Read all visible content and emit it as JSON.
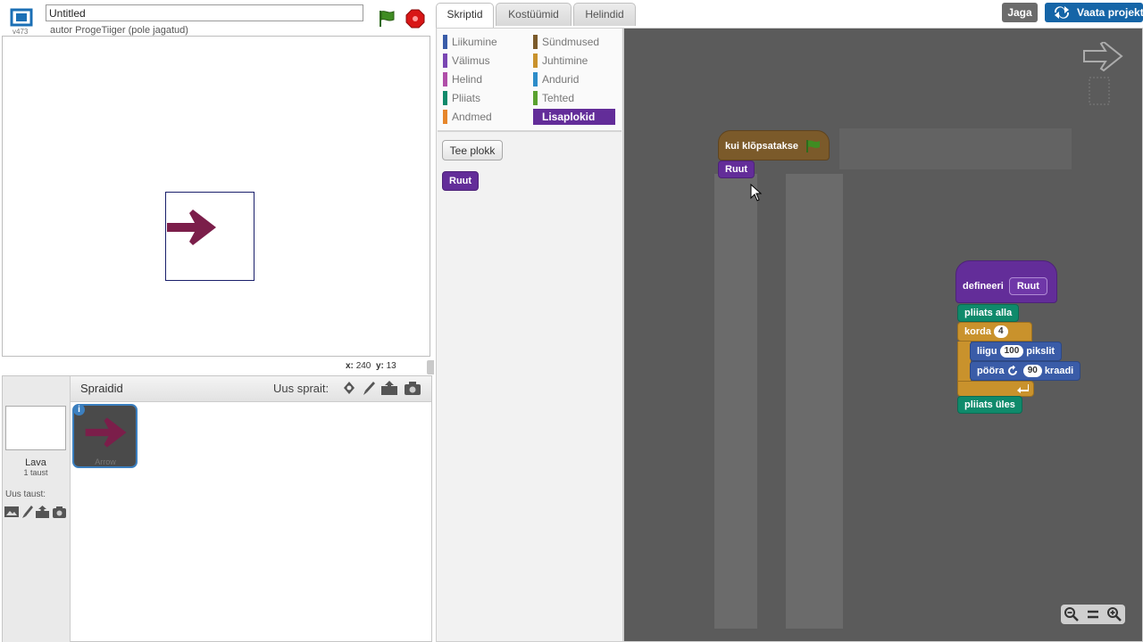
{
  "header": {
    "project_title": "Untitled",
    "author_line": "autor ProgeTiiger (pole jagatud)",
    "version": "v473"
  },
  "stage": {
    "x_label": "x:",
    "x_value": "240",
    "y_label": "y:",
    "y_value": "13"
  },
  "sprites_panel": {
    "title": "Spraidid",
    "new_sprite_label": "Uus sprait:",
    "stage_name": "Lava",
    "stage_backdrops": "1 taust",
    "new_backdrop_label": "Uus taust:",
    "sprite_name": "Arrow"
  },
  "tabs": [
    "Skriptid",
    "Kostüümid",
    "Helindid"
  ],
  "top_buttons": {
    "share": "Jaga",
    "see_project": "Vaata projekti"
  },
  "categories": [
    {
      "label": "Liikumine",
      "color": "#3a5ca8"
    },
    {
      "label": "Välimus",
      "color": "#7a47b3"
    },
    {
      "label": "Helind",
      "color": "#b04ea8"
    },
    {
      "label": "Pliiats",
      "color": "#0f8a6b"
    },
    {
      "label": "Andmed",
      "color": "#e6862b"
    },
    {
      "label": "Sündmused",
      "color": "#7b5a2a"
    },
    {
      "label": "Juhtimine",
      "color": "#c9922c"
    },
    {
      "label": "Andurid",
      "color": "#2d8cc9"
    },
    {
      "label": "Tehted",
      "color": "#5aa12f"
    },
    {
      "label": "Lisaplokid",
      "color": "#632d99"
    }
  ],
  "palette": {
    "make_block": "Tee plokk",
    "custom_block": "Ruut"
  },
  "scripts": {
    "when_flag": "kui klõpsatakse",
    "call_block": "Ruut",
    "define_label": "defineeri",
    "define_name": "Ruut",
    "pen_down": "pliiats alla",
    "repeat_label": "korda",
    "repeat_count": "4",
    "move_label": "liigu",
    "move_steps": "100",
    "move_unit": "pikslit",
    "turn_label": "pööra",
    "turn_degrees": "90",
    "turn_unit": "kraadi",
    "pen_up": "pliiats üles"
  }
}
